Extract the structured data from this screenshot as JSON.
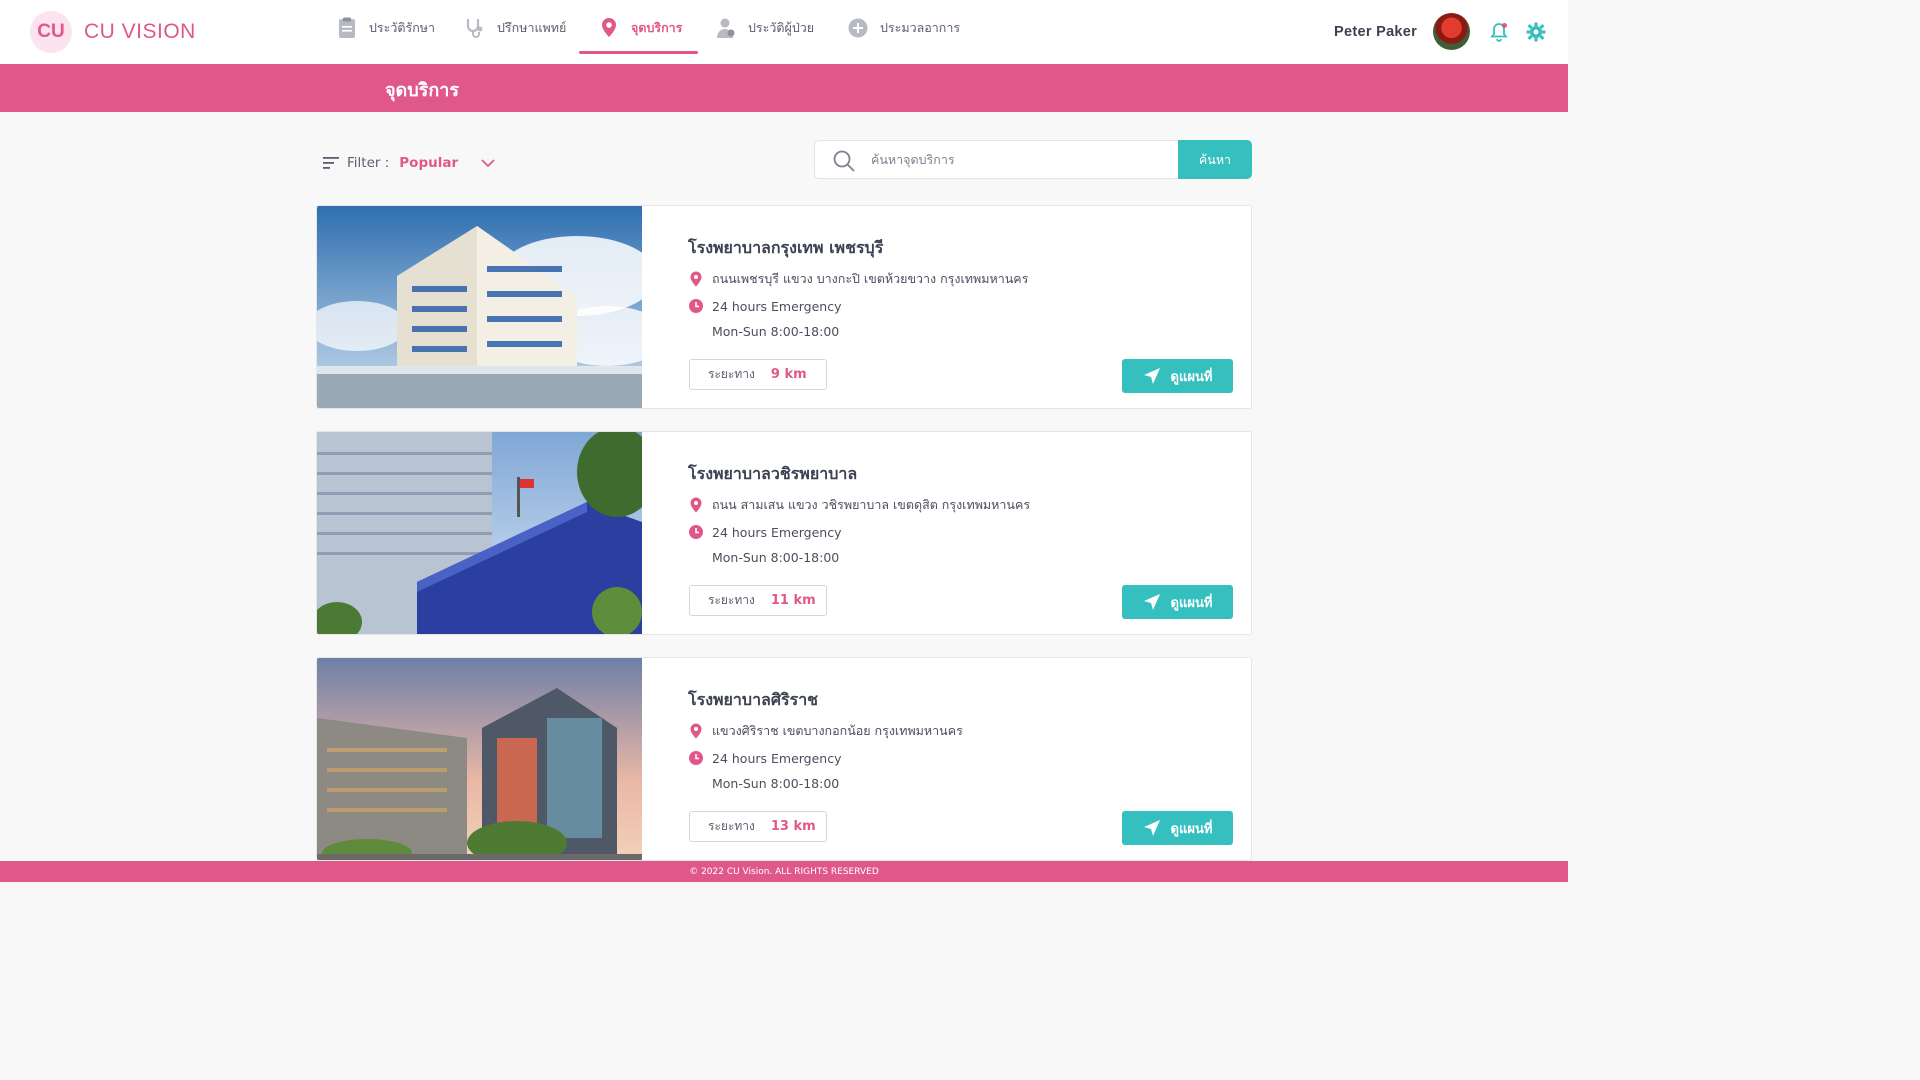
{
  "brand": {
    "logo": "CU",
    "name": "CU VISION",
    "color": "#e0588a"
  },
  "nav": {
    "items": [
      {
        "label": "ประวัติรักษา",
        "icon": "clipboard-icon"
      },
      {
        "label": "ปรึกษาแพทย์",
        "icon": "stethoscope-icon"
      },
      {
        "label": "จุดบริการ",
        "icon": "location-pin-icon",
        "active": true
      },
      {
        "label": "ประวัติผู้ป่วย",
        "icon": "patient-icon"
      },
      {
        "label": "ประมวลอาการ",
        "icon": "plus-circle-icon"
      }
    ]
  },
  "user": {
    "name": "Peter Paker"
  },
  "banner": {
    "title": "จุดบริการ"
  },
  "filter": {
    "label": "Filter :",
    "value": "Popular"
  },
  "search": {
    "placeholder": "ค้นหาจุดบริการ",
    "button": "ค้นหา"
  },
  "accent_color": "#36bfbf",
  "services": [
    {
      "name": "โรงพยาบาลกรุงเทพ เพชรบุรี",
      "address": "ถนนเพชรบุรี แขวง บางกะปิ เขตห้วยขวาง กรุงเทพมหานคร",
      "hours": "24 hours Emergency",
      "hours2": "Mon-Sun 8:00-18:00",
      "distance_label": "ระยะทาง",
      "distance": "9 km",
      "map_button": "ดูแผนที่"
    },
    {
      "name": "โรงพยาบาลวชิรพยาบาล",
      "address": "ถนน สามเสน แขวง วชิรพยาบาล เขตดุสิต กรุงเทพมหานคร",
      "hours": "24 hours Emergency",
      "hours2": "Mon-Sun 8:00-18:00",
      "distance_label": "ระยะทาง",
      "distance": "11 km",
      "map_button": "ดูแผนที่"
    },
    {
      "name": "โรงพยาบาลศิริราช",
      "address": "แขวงศิริราช เขตบางกอกน้อย กรุงเทพมหานคร",
      "hours": "24 hours Emergency",
      "hours2": "Mon-Sun 8:00-18:00",
      "distance_label": "ระยะทาง",
      "distance": "13 km",
      "map_button": "ดูแผนที่"
    }
  ],
  "footer": {
    "text": "© 2022 CU Vision. ALL RIGHTS RESERVED"
  }
}
